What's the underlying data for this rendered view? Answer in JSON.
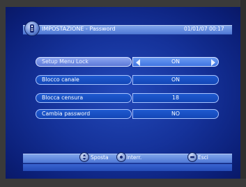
{
  "header": {
    "title": "IMPOSTAZIONE - Password",
    "datetime": "01/01/07 00:17",
    "icon": "settings-remote-icon"
  },
  "menu": {
    "rows": [
      {
        "label": "Setup Menu Lock",
        "value": "ON",
        "selected": true
      },
      {
        "label": "Blocco canale",
        "value": "ON",
        "selected": false
      },
      {
        "label": "Blocca censura",
        "value": "18",
        "selected": false
      },
      {
        "label": "Cambia password",
        "value": "NO",
        "selected": false
      }
    ]
  },
  "footer": {
    "move_label": "Sposta",
    "move_icon": "up-down-navigation-icon",
    "interrupt_label": "Interr.",
    "interrupt_icon": "ok-select-icon",
    "exit_label": "Esci",
    "exit_icon": "exit-button-icon"
  },
  "colors": {
    "background": "#15329a",
    "header_bar": "#6a90e0",
    "pill": "#1a50c4",
    "pill_selected": "#7a94e8"
  }
}
